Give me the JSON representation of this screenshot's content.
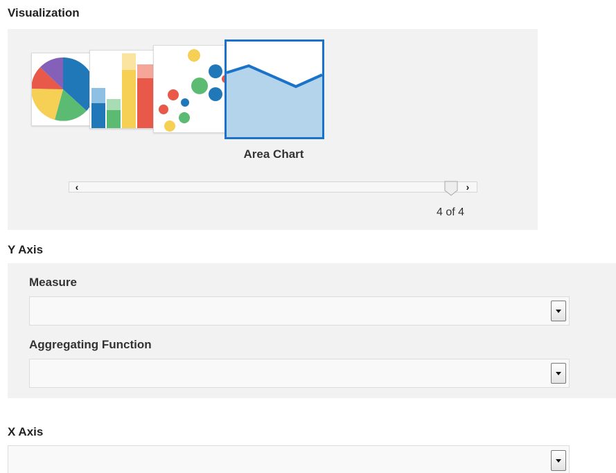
{
  "visualization": {
    "title": "Visualization",
    "carousel": {
      "items": [
        {
          "name": "Pie Chart"
        },
        {
          "name": "Bar Chart"
        },
        {
          "name": "Bubble Chart"
        },
        {
          "name": "Area Chart"
        }
      ],
      "selected_label": "Area Chart",
      "page_indicator": "4 of 4",
      "scroll_prev_glyph": "‹",
      "scroll_next_glyph": "›",
      "scroll_position": 1.0
    },
    "selected_color": "#1a73c8"
  },
  "y_axis": {
    "title": "Y Axis",
    "measure_label": "Measure",
    "measure_value": "",
    "aggregating_function_label": "Aggregating Function",
    "aggregating_function_value": ""
  },
  "x_axis": {
    "title": "X Axis",
    "value": ""
  },
  "icons": {
    "dropdown": "chevron-down-icon",
    "scroll_prev": "chevron-left-icon",
    "scroll_next": "chevron-right-icon"
  }
}
